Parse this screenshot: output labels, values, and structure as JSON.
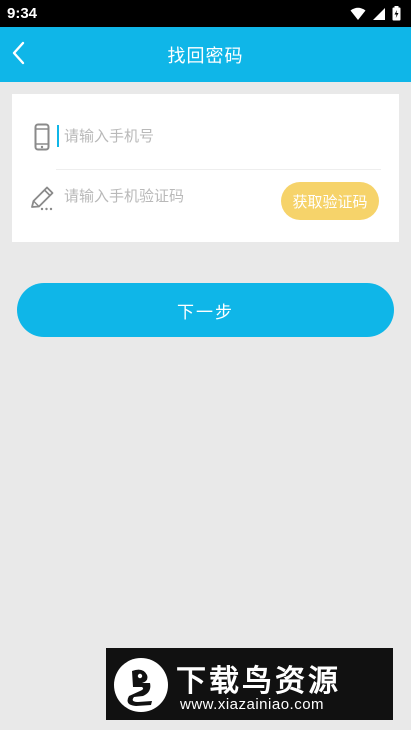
{
  "status_bar": {
    "time": "9:34",
    "icons": [
      "wifi-icon",
      "signal-icon",
      "battery-icon"
    ]
  },
  "app_bar": {
    "title": "找回密码",
    "back_icon": "chevron-left-icon"
  },
  "form": {
    "phone": {
      "icon": "mobile-phone-icon",
      "placeholder": "请输入手机号",
      "value": ""
    },
    "code": {
      "icon": "pencil-icon",
      "placeholder": "请输入手机验证码",
      "value": "",
      "button_label": "获取验证码"
    }
  },
  "next_button_label": "下一步",
  "watermark": {
    "name": "下载鸟资源",
    "url": "www.xiazainiao.com"
  },
  "colors": {
    "primary": "#0fb6e8",
    "accent_button": "#f6d36a",
    "background": "#e9e9e9"
  }
}
